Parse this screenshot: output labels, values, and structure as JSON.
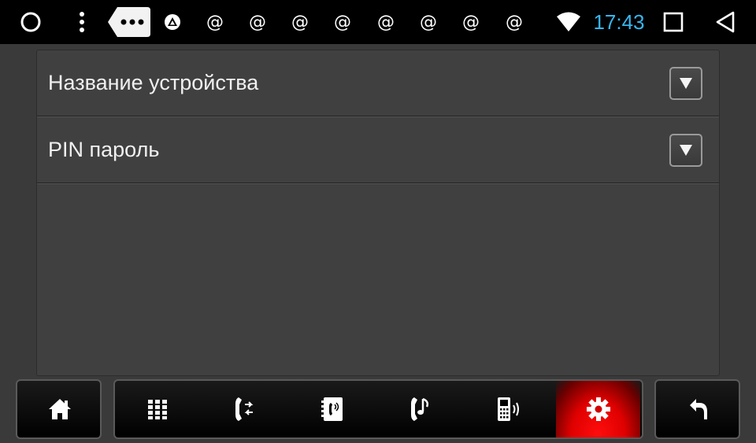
{
  "status_bar": {
    "time": "17:43",
    "notifications": [
      "@",
      "@",
      "@",
      "@",
      "@",
      "@",
      "@",
      "@"
    ],
    "icons": [
      "circle-icon",
      "overflow-menu-icon",
      "chat-bubble-icon",
      "warning-icon",
      "wifi-icon",
      "square-icon",
      "back-triangle-icon"
    ]
  },
  "settings": {
    "rows": [
      {
        "label": "Название устройства",
        "icon": "dropdown-arrow-icon"
      },
      {
        "label": "PIN пароль",
        "icon": "dropdown-arrow-icon"
      }
    ]
  },
  "bottom_nav": {
    "items": [
      "home-icon",
      "dialpad-icon",
      "call-transfer-icon",
      "contacts-icon",
      "music-phone-icon",
      "mobile-signal-icon",
      "settings-gear-icon",
      "back-arrow-icon"
    ],
    "active": "settings-gear-icon"
  },
  "colors": {
    "background": "#3a3a3a",
    "status_bar": "#000000",
    "time": "#37b6f0",
    "active_button": "#e00000"
  }
}
